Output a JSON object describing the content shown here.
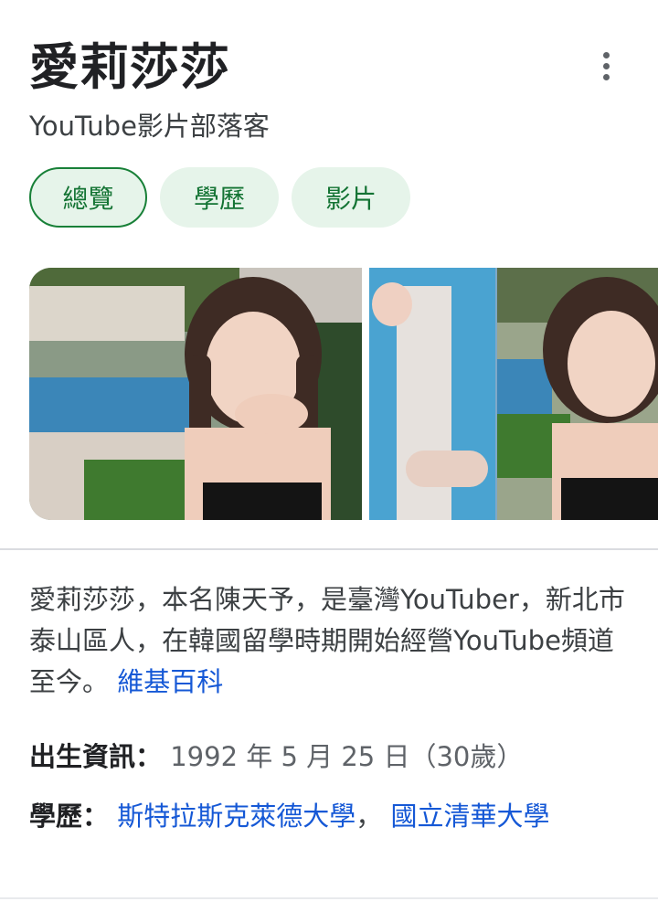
{
  "header": {
    "title": "愛莉莎莎",
    "subtitle": "YouTube影片部落客"
  },
  "tabs": [
    {
      "label": "總覽",
      "active": true
    },
    {
      "label": "學歷",
      "active": false
    },
    {
      "label": "影片",
      "active": false
    }
  ],
  "icons": {
    "more": "more-vert-icon"
  },
  "description": {
    "text": "愛莉莎莎，本名陳天予，是臺灣YouTuber，新北市泰山區人，在韓國留學時期開始經營YouTube頻道至今。",
    "source_link": "維基百科"
  },
  "facts": {
    "birth": {
      "label": "出生資訊：",
      "value": "1992 年 5 月 25 日（30歲）"
    },
    "education": {
      "label": "學歷：",
      "school1": "斯特拉斯克萊德大學",
      "separator": "，",
      "school2": "國立清華大學"
    }
  },
  "colors": {
    "chip_bg": "#e6f4ea",
    "chip_text": "#137333",
    "link": "#1558d6",
    "divider": "#dadce0"
  }
}
